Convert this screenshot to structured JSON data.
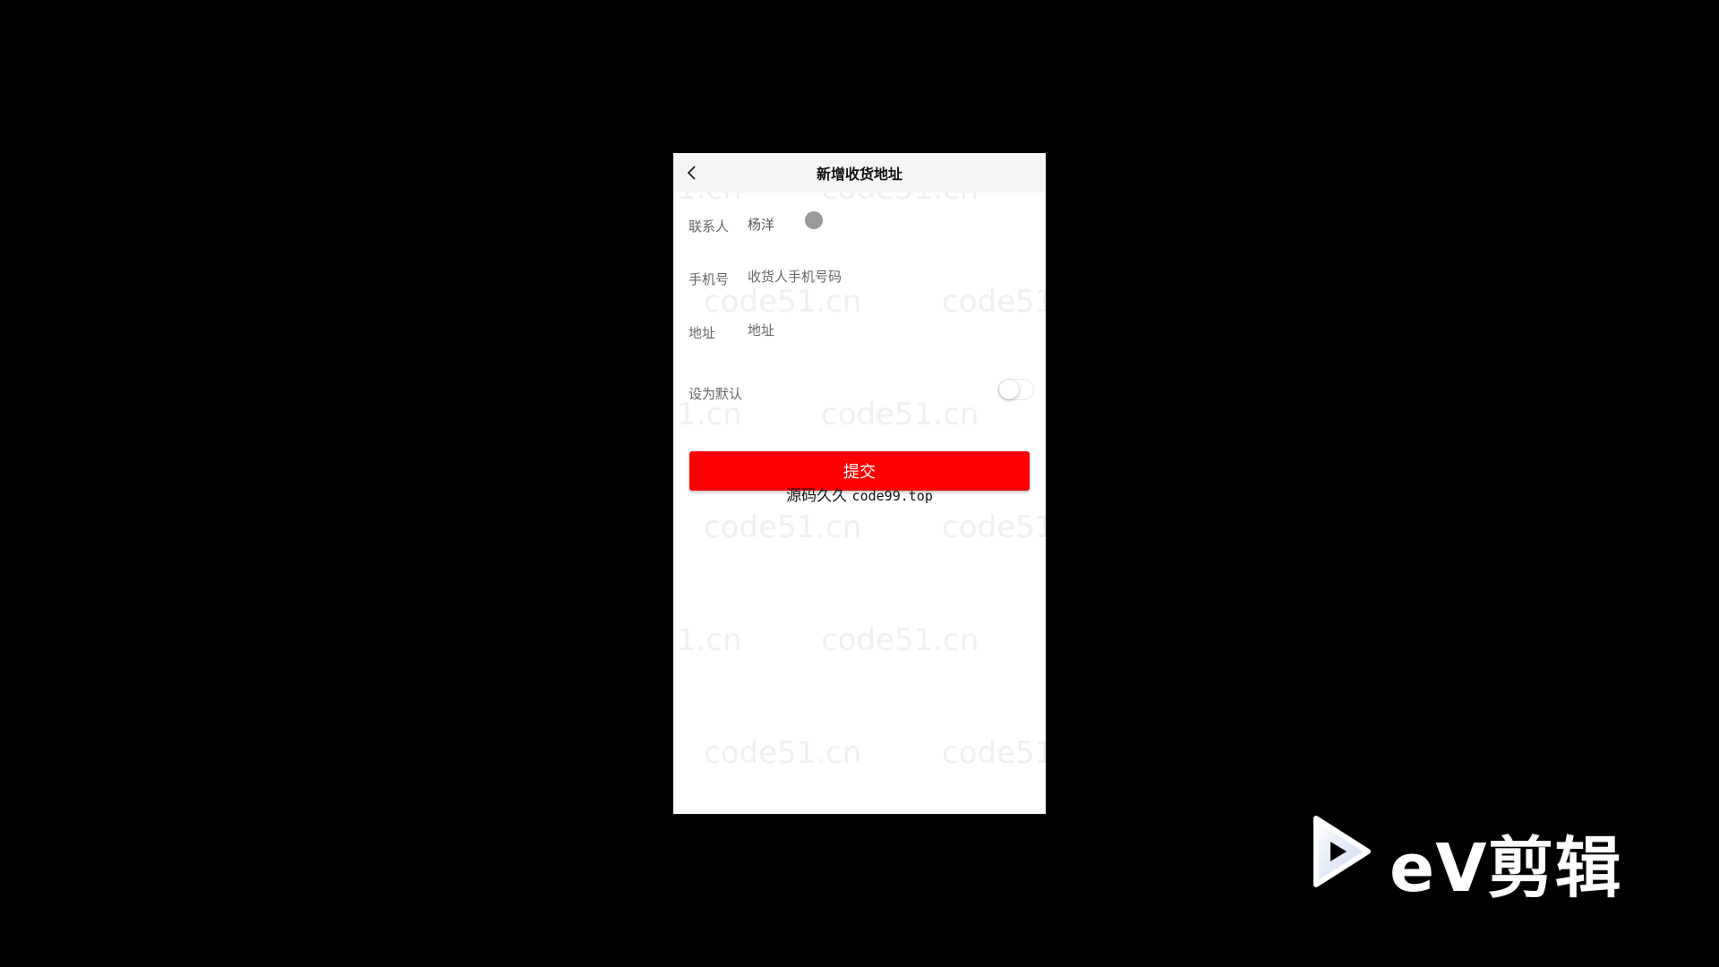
{
  "nav": {
    "title": "新增收货地址"
  },
  "form": {
    "contact": {
      "label": "联系人",
      "value": "杨洋"
    },
    "phone": {
      "label": "手机号",
      "placeholder": "收货人手机号码"
    },
    "address": {
      "label": "地址",
      "placeholder": "地址"
    },
    "default": {
      "label": "设为默认",
      "enabled": false
    }
  },
  "submit_label": "提交",
  "overlay_caption": {
    "cn": "源码久久",
    "url": "code99.top"
  },
  "watermarks": [
    "1.cn",
    "code51.cn",
    "code51.cn",
    "code51",
    "1.cn",
    "code51.cn",
    "code51.cn",
    "code51",
    "1.cn",
    "code51.cn",
    "code51.cn",
    "code51"
  ],
  "video_logo": {
    "text": "eV剪辑"
  },
  "colors": {
    "accent": "#fe0000",
    "navbar": "#f5f5f5",
    "background": "#000000"
  }
}
